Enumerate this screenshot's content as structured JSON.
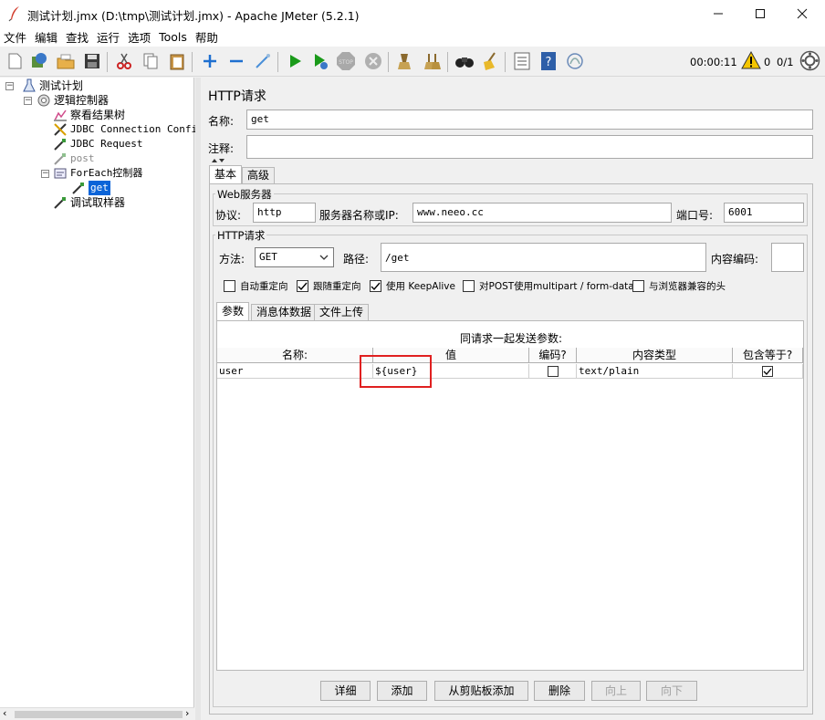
{
  "window": {
    "title": "测试计划.jmx (D:\\tmp\\测试计划.jmx) - Apache JMeter (5.2.1)"
  },
  "menu": [
    "文件",
    "编辑",
    "查找",
    "运行",
    "选项",
    "Tools",
    "帮助"
  ],
  "toolbar": {
    "timer": "00:00:11",
    "warning_count": "0",
    "threads": "0/1"
  },
  "tree": {
    "root": "测试计划",
    "logic_controller": "逻辑控制器",
    "view_results": "察看结果树",
    "jdbc_config": "JDBC Connection Configuration",
    "jdbc_request": "JDBC Request",
    "post": "post",
    "foreach": "ForEach控制器",
    "get": "get",
    "debug": "调试取样器"
  },
  "panel": {
    "heading": "HTTP请求",
    "name_label": "名称:",
    "name_value": "get",
    "comment_label": "注释:",
    "comment_value": "",
    "tabs": [
      "基本",
      "高级"
    ],
    "web_server": {
      "title": "Web服务器",
      "protocol_label": "协议:",
      "protocol_value": "http",
      "server_label": "服务器名称或IP:",
      "server_value": "www.neeo.cc",
      "port_label": "端口号:",
      "port_value": "6001"
    },
    "http_request": {
      "title": "HTTP请求",
      "method_label": "方法:",
      "method_value": "GET",
      "path_label": "路径:",
      "path_value": "/get",
      "encoding_label": "内容编码:",
      "encoding_value": ""
    },
    "options": [
      {
        "label": "自动重定向",
        "checked": false
      },
      {
        "label": "跟随重定向",
        "checked": true
      },
      {
        "label": "使用 KeepAlive",
        "checked": true
      },
      {
        "label": "对POST使用multipart / form-data",
        "checked": false
      },
      {
        "label": "与浏览器兼容的头",
        "checked": false
      }
    ],
    "sub_tabs": [
      "参数",
      "消息体数据",
      "文件上传"
    ],
    "table_caption": "同请求一起发送参数:",
    "columns": [
      "名称:",
      "值",
      "编码?",
      "内容类型",
      "包含等于?"
    ],
    "rows": [
      {
        "name": "user",
        "value": "${user}",
        "encode": false,
        "content_type": "text/plain",
        "include_equals": true
      }
    ],
    "buttons": {
      "detail": "详细",
      "add": "添加",
      "add_clipboard": "从剪贴板添加",
      "delete": "删除",
      "up": "向上",
      "down": "向下"
    }
  },
  "colors": {
    "highlight_box": "#e02020",
    "selected_node": "#0b64d8",
    "run_green": "#1a9a1a",
    "add_blue": "#1e6fd0"
  }
}
